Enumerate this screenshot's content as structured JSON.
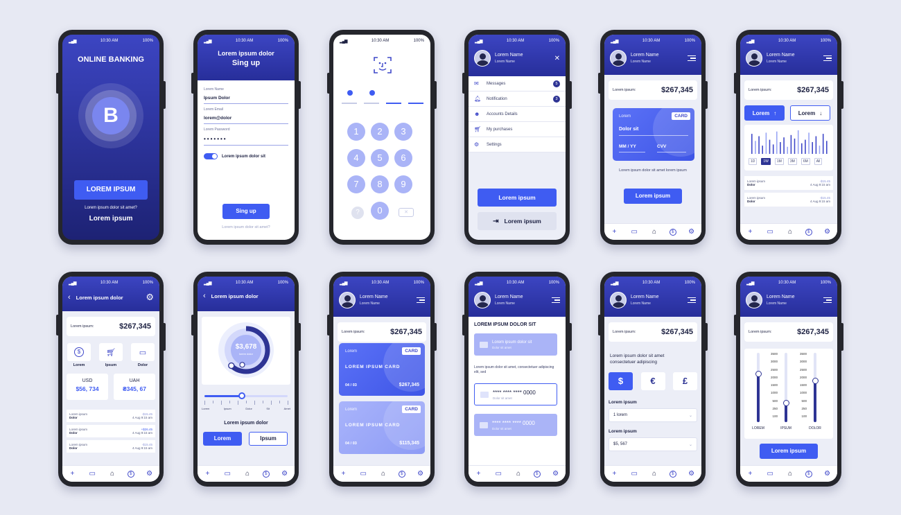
{
  "status": {
    "time": "10:30 AM",
    "battery": "100%"
  },
  "colors": {
    "primary": "#3f5cf2",
    "navy": "#2e3494",
    "background": "#e7e9f3",
    "light_blue": "#aab4f7"
  },
  "user": {
    "name": "Lorem Name",
    "sub": "Lorem Name"
  },
  "tabbar": [
    "plus-icon",
    "wallet-icon",
    "home-icon",
    "dollar-icon",
    "gear-icon"
  ],
  "splash": {
    "title": "ONLINE BANKING",
    "logo_letter": "B",
    "button": "LOREM IPSUM",
    "question": "Lorem ipsum dolor sit amet?",
    "link": "Lorem ipsum"
  },
  "signup": {
    "title_line1": "Lorem ipsum dolor",
    "title_line2": "Sing up",
    "name_label": "Lorem Name",
    "name_value": "Ipsum Dolor",
    "email_label": "Lorem Email",
    "email_value": "lorem@dolor",
    "password_label": "Lorem Password",
    "password_value": "•••••••",
    "toggle_label": "Lorem ipsum dolor sit",
    "toggle_on": true,
    "button": "Sing up",
    "footer": "Lorem ipsum dolor sit amet?"
  },
  "pin": {
    "keys": [
      "1",
      "2",
      "3",
      "4",
      "5",
      "6",
      "7",
      "8",
      "9"
    ],
    "help": "?",
    "zero": "0",
    "delete": "✕",
    "entered": 2,
    "length": 4
  },
  "menu": {
    "items": [
      {
        "label": "Messages",
        "count": "5",
        "icon": "mail-icon"
      },
      {
        "label": "Notification",
        "count": "3",
        "icon": "bell-icon"
      },
      {
        "label": "Accounts Details",
        "count": "",
        "icon": "user-icon"
      },
      {
        "label": "My purchases",
        "count": "",
        "icon": "cart-icon"
      },
      {
        "label": "Settings",
        "count": "",
        "icon": "gear-icon"
      }
    ],
    "primary_button": "Lorem ipsum",
    "logout_button": "Lorem ipsum"
  },
  "cardscreen": {
    "balance_label": "Lorem ipsum:",
    "balance": "$267,345",
    "card_brand": "Lorem",
    "card_tag": "CARD",
    "card_name": "Dolor sit",
    "card_expiry": "MM / YY",
    "card_cvv": "CVV",
    "note": "Lorem ipsum dolor sit amet lorem ipsum",
    "button": "Lorem ipsum"
  },
  "stats": {
    "balance_label": "Lorem ipsum:",
    "balance": "$267,345",
    "btn_up": "Lorem",
    "btn_down": "Lorem",
    "ranges": [
      "1D",
      "1W",
      "1M",
      "3M",
      "6M",
      "All"
    ],
    "active_range": "1W",
    "chart_data": {
      "type": "bar",
      "values": [
        0.85,
        0.55,
        0.75,
        0.35,
        0.9,
        0.6,
        0.4,
        0.95,
        0.5,
        0.7,
        0.3,
        0.8,
        0.65,
        1.0,
        0.45,
        0.6,
        0.9,
        0.5,
        0.75,
        0.35,
        0.85,
        0.55
      ]
    },
    "transactions": [
      {
        "title": "Lorem ipsum",
        "name": "Dolor",
        "amount": "-$15.45",
        "date": "4 Aug  9:15 am"
      },
      {
        "title": "Lorem ipsum",
        "name": "Dolor",
        "amount": "-$15.45",
        "date": "4 Aug  9:15 am"
      }
    ]
  },
  "overview": {
    "title": "Lorem ipsum dolor",
    "balance_label": "Lorem ipsum:",
    "balance": "$267,345",
    "actions": [
      {
        "label": "Lorem",
        "icon": "dollar-icon"
      },
      {
        "label": "Ipsum",
        "icon": "cart-icon"
      },
      {
        "label": "Dolor",
        "icon": "wallet-icon"
      }
    ],
    "currencies": [
      {
        "code": "USD",
        "value": "$56, 734"
      },
      {
        "code": "UAH",
        "value": "₴345, 67"
      }
    ],
    "transactions": [
      {
        "title": "Lorem ipsum",
        "name": "Dolor",
        "amount": "-$15.45",
        "date": "4 Aug  9:15 am",
        "positive": false
      },
      {
        "title": "Lorem ipsum",
        "name": "Dolor",
        "amount": "+$26.45",
        "date": "4 Aug  9:15 am",
        "positive": true
      },
      {
        "title": "Lorem ipsum",
        "name": "Dolor",
        "amount": "-$15.45",
        "date": "4 Aug  9:15 am",
        "positive": false
      }
    ]
  },
  "donut": {
    "title": "Lorem ipsum dolor",
    "amount": "$3,678",
    "amount_sub": "lorem dolor",
    "fill": 0.62,
    "slider_value": 0.45,
    "slider_labels": [
      "Lorem",
      "Ipsum",
      "Dolor",
      "Sit",
      "Amet"
    ],
    "subtitle": "Lorem ipsum dolor",
    "btn_primary": "Lorem",
    "btn_secondary": "Ipsum"
  },
  "cards": {
    "balance_label": "Lorem ipsum:",
    "balance": "$267,345",
    "items": [
      {
        "brand": "Lorem",
        "tag": "CARD",
        "number": "LOREM IPSUM CARD",
        "expiry": "04 / 03",
        "amount": "$267,345"
      },
      {
        "brand": "Lorem",
        "tag": "CARD",
        "number": "LOREM IPSUM CARD",
        "expiry": "04 / 03",
        "amount": "$115,345"
      }
    ]
  },
  "select_card": {
    "title": "LOREM IPSUM DOLOR SIT",
    "card1_title": "Lorem ipsum dolor sit",
    "card1_sub": "Dolor sit amet",
    "text": "Lorem ipsum dolor sit amet, consectetuer adipiscing elit, sed",
    "card2_number": "**** **** **** 0000",
    "card2_sub": "Dolor sit amet",
    "card3_number": "**** **** **** 0000",
    "card3_sub": "Dolor sit amet"
  },
  "exchange": {
    "balance_label": "Lorem ipsum:",
    "balance": "$267,345",
    "text": "Lorem ipsum dolor sit amet consectetuer adipiscing",
    "currencies": [
      "$",
      "€",
      "£"
    ],
    "active_currency": "$",
    "label1": "Lorem ipsum",
    "value1": "1 lorem",
    "label2": "Lorem ipsum",
    "value2": "$5, 567"
  },
  "sliders": {
    "balance_label": "Lorem ipsum:",
    "balance": "$267,345",
    "ticks": [
      "3500",
      "3000",
      "2500",
      "2000",
      "1500",
      "1000",
      "500",
      "250",
      "100"
    ],
    "bars": [
      {
        "label": "LOREM",
        "value": 0.7
      },
      {
        "label": "IPSUM",
        "value": 0.28
      },
      {
        "label": "DOLOR",
        "value": 0.6
      }
    ],
    "button": "Lorem ipsum"
  }
}
